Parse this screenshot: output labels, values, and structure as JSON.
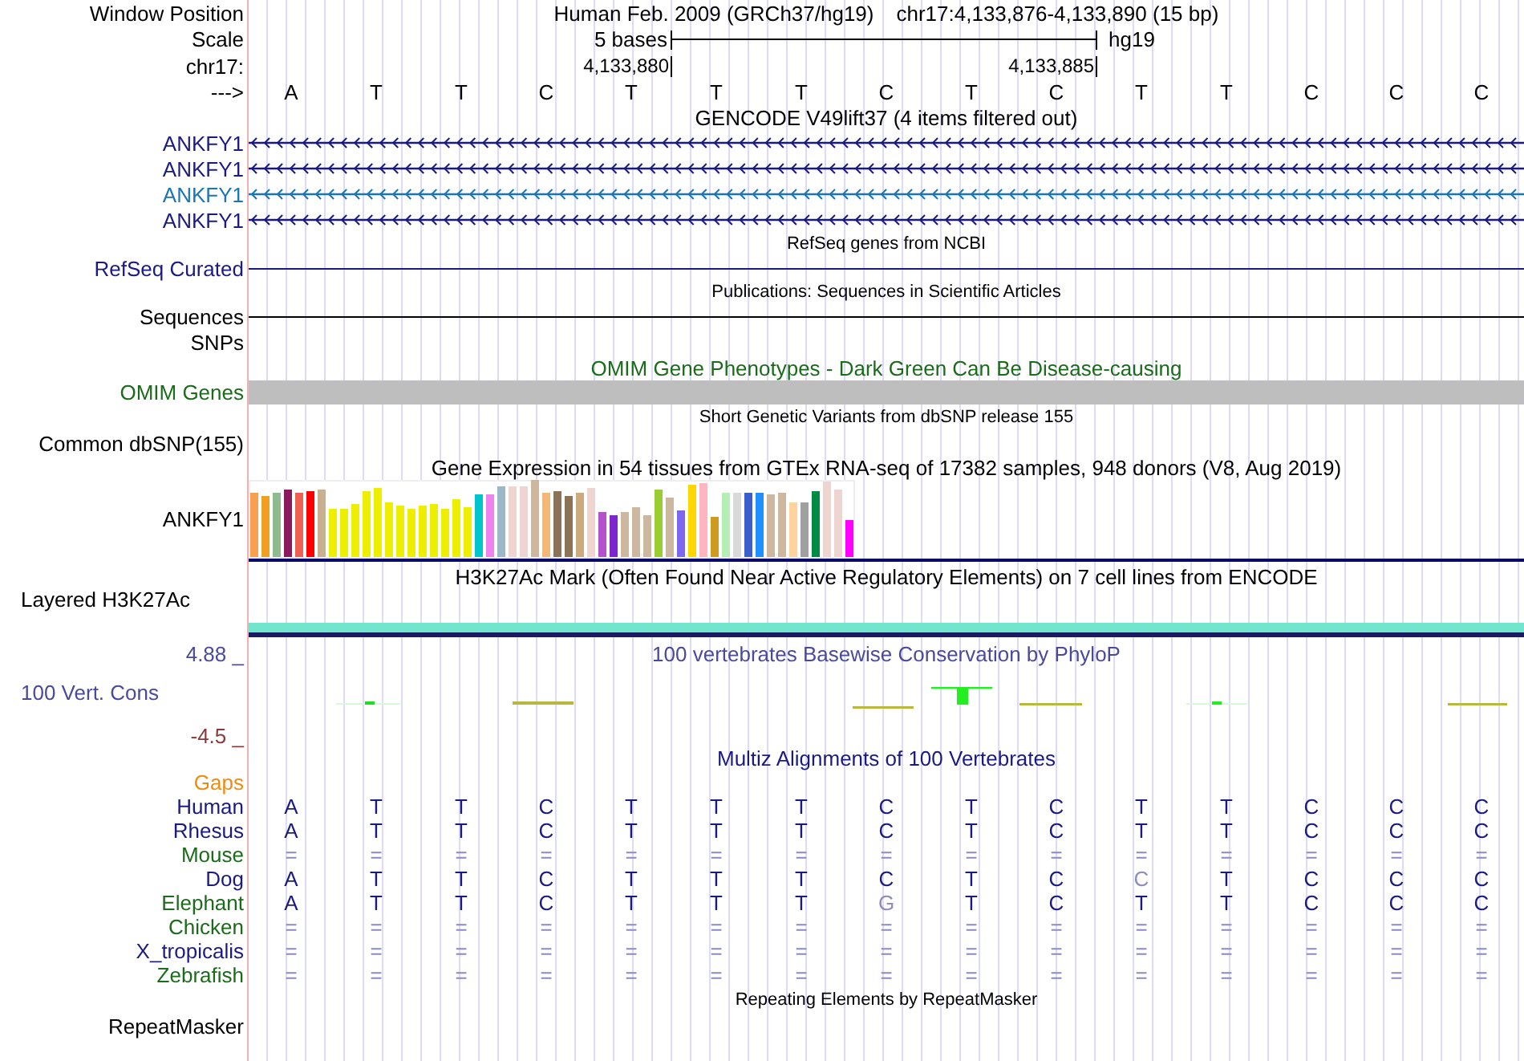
{
  "header": {
    "label": "Window Position",
    "title": "Human Feb. 2009 (GRCh37/hg19)",
    "position": "chr17:4,133,876-4,133,890 (15 bp)"
  },
  "scale": {
    "label": "Scale",
    "span": "5 bases",
    "assembly": "hg19"
  },
  "coordinates": {
    "label": "chr17:",
    "ticks": [
      "4,133,880",
      "4,133,885"
    ]
  },
  "sequence": {
    "label": "--->",
    "bases": [
      "A",
      "T",
      "T",
      "C",
      "T",
      "T",
      "T",
      "C",
      "T",
      "C",
      "T",
      "T",
      "C",
      "C",
      "C"
    ]
  },
  "tracks": [
    {
      "kind": "genes",
      "title": "GENCODE V49lift37 (4 items filtered out)",
      "items": [
        {
          "name": "ANKFY1",
          "color": "#1a1a80"
        },
        {
          "name": "ANKFY1",
          "color": "#1a1a80"
        },
        {
          "name": "ANKFY1",
          "color": "#1b75b5"
        },
        {
          "name": "ANKFY1",
          "color": "#1a1a80"
        }
      ]
    },
    {
      "kind": "line",
      "title": "RefSeq genes from NCBI",
      "label": "RefSeq Curated",
      "color": "#1a1a80"
    },
    {
      "kind": "line",
      "title": "Publications: Sequences in Scientific Articles",
      "label": "Sequences",
      "color": "#000000"
    },
    {
      "kind": "empty",
      "label": "SNPs",
      "color": "#000000"
    },
    {
      "kind": "omim",
      "title": "OMIM Gene Phenotypes - Dark Green Can Be Disease-causing",
      "label": "OMIM Genes",
      "color": "#1a6b1a"
    },
    {
      "kind": "empty",
      "title": "Short Genetic Variants from dbSNP release 155",
      "label": "Common dbSNP(155)",
      "color": "#000000"
    },
    {
      "kind": "expression",
      "title": "Gene Expression in 54 tissues from GTEx RNA-seq of 17382 samples, 948 donors (V8, Aug 2019)",
      "label": "ANKFY1",
      "color": "#000000"
    },
    {
      "kind": "layered",
      "title": "H3K27Ac Mark (Often Found Near Active Regulatory Elements) on 7 cell lines from ENCODE",
      "label": "Layered H3K27Ac",
      "color": "#000000"
    },
    {
      "kind": "conservation",
      "title": "100 vertebrates Basewise Conservation by PhyloP",
      "label": "100 Vert. Cons",
      "max": "4.88 _",
      "min": "-4.5 _",
      "color": "#4a4a9a"
    },
    {
      "kind": "alignment",
      "title": "Multiz Alignments of 100 Vertebrates",
      "gaps_label": "Gaps",
      "species": [
        {
          "name": "Human",
          "color": "#1a1a80",
          "bases": [
            {
              "b": "A",
              "faded": false
            },
            {
              "b": "T",
              "faded": false
            },
            {
              "b": "T",
              "faded": false
            },
            {
              "b": "C",
              "faded": false
            },
            {
              "b": "T",
              "faded": false
            },
            {
              "b": "T",
              "faded": false
            },
            {
              "b": "T",
              "faded": false
            },
            {
              "b": "C",
              "faded": false
            },
            {
              "b": "T",
              "faded": false
            },
            {
              "b": "C",
              "faded": false
            },
            {
              "b": "T",
              "faded": false
            },
            {
              "b": "T",
              "faded": false
            },
            {
              "b": "C",
              "faded": false
            },
            {
              "b": "C",
              "faded": false
            },
            {
              "b": "C",
              "faded": false
            }
          ]
        },
        {
          "name": "Rhesus",
          "color": "#1a1a80",
          "bases": [
            {
              "b": "A",
              "faded": false
            },
            {
              "b": "T",
              "faded": false
            },
            {
              "b": "T",
              "faded": false
            },
            {
              "b": "C",
              "faded": false
            },
            {
              "b": "T",
              "faded": false
            },
            {
              "b": "T",
              "faded": false
            },
            {
              "b": "T",
              "faded": false
            },
            {
              "b": "C",
              "faded": false
            },
            {
              "b": "T",
              "faded": false
            },
            {
              "b": "C",
              "faded": false
            },
            {
              "b": "T",
              "faded": false
            },
            {
              "b": "T",
              "faded": false
            },
            {
              "b": "C",
              "faded": false
            },
            {
              "b": "C",
              "faded": false
            },
            {
              "b": "C",
              "faded": false
            }
          ]
        },
        {
          "name": "Mouse",
          "color": "#1a6b1a",
          "bases": [
            {
              "b": "=",
              "faded": true
            },
            {
              "b": "=",
              "faded": true
            },
            {
              "b": "=",
              "faded": true
            },
            {
              "b": "=",
              "faded": true
            },
            {
              "b": "=",
              "faded": true
            },
            {
              "b": "=",
              "faded": true
            },
            {
              "b": "=",
              "faded": true
            },
            {
              "b": "=",
              "faded": true
            },
            {
              "b": "=",
              "faded": true
            },
            {
              "b": "=",
              "faded": true
            },
            {
              "b": "=",
              "faded": true
            },
            {
              "b": "=",
              "faded": true
            },
            {
              "b": "=",
              "faded": true
            },
            {
              "b": "=",
              "faded": true
            },
            {
              "b": "=",
              "faded": true
            }
          ]
        },
        {
          "name": "Dog",
          "color": "#1a1a80",
          "bases": [
            {
              "b": "A",
              "faded": false
            },
            {
              "b": "T",
              "faded": false
            },
            {
              "b": "T",
              "faded": false
            },
            {
              "b": "C",
              "faded": false
            },
            {
              "b": "T",
              "faded": false
            },
            {
              "b": "T",
              "faded": false
            },
            {
              "b": "T",
              "faded": false
            },
            {
              "b": "C",
              "faded": false
            },
            {
              "b": "T",
              "faded": false
            },
            {
              "b": "C",
              "faded": false
            },
            {
              "b": "C",
              "faded": true
            },
            {
              "b": "T",
              "faded": false
            },
            {
              "b": "C",
              "faded": false
            },
            {
              "b": "C",
              "faded": false
            },
            {
              "b": "C",
              "faded": false
            }
          ]
        },
        {
          "name": "Elephant",
          "color": "#1a6b1a",
          "bases": [
            {
              "b": "A",
              "faded": false
            },
            {
              "b": "T",
              "faded": false
            },
            {
              "b": "T",
              "faded": false
            },
            {
              "b": "C",
              "faded": false
            },
            {
              "b": "T",
              "faded": false
            },
            {
              "b": "T",
              "faded": false
            },
            {
              "b": "T",
              "faded": false
            },
            {
              "b": "G",
              "faded": true
            },
            {
              "b": "T",
              "faded": false
            },
            {
              "b": "C",
              "faded": false
            },
            {
              "b": "T",
              "faded": false
            },
            {
              "b": "T",
              "faded": false
            },
            {
              "b": "C",
              "faded": false
            },
            {
              "b": "C",
              "faded": false
            },
            {
              "b": "C",
              "faded": false
            }
          ]
        },
        {
          "name": "Chicken",
          "color": "#1a6b1a",
          "bases": [
            {
              "b": "=",
              "faded": true
            },
            {
              "b": "=",
              "faded": true
            },
            {
              "b": "=",
              "faded": true
            },
            {
              "b": "=",
              "faded": true
            },
            {
              "b": "=",
              "faded": true
            },
            {
              "b": "=",
              "faded": true
            },
            {
              "b": "=",
              "faded": true
            },
            {
              "b": "=",
              "faded": true
            },
            {
              "b": "=",
              "faded": true
            },
            {
              "b": "=",
              "faded": true
            },
            {
              "b": "=",
              "faded": true
            },
            {
              "b": "=",
              "faded": true
            },
            {
              "b": "=",
              "faded": true
            },
            {
              "b": "=",
              "faded": true
            },
            {
              "b": "=",
              "faded": true
            }
          ]
        },
        {
          "name": "X_tropicalis",
          "color": "#1a1a80",
          "bases": [
            {
              "b": "=",
              "faded": true
            },
            {
              "b": "=",
              "faded": true
            },
            {
              "b": "=",
              "faded": true
            },
            {
              "b": "=",
              "faded": true
            },
            {
              "b": "=",
              "faded": true
            },
            {
              "b": "=",
              "faded": true
            },
            {
              "b": "=",
              "faded": true
            },
            {
              "b": "=",
              "faded": true
            },
            {
              "b": "=",
              "faded": true
            },
            {
              "b": "=",
              "faded": true
            },
            {
              "b": "=",
              "faded": true
            },
            {
              "b": "=",
              "faded": true
            },
            {
              "b": "=",
              "faded": true
            },
            {
              "b": "=",
              "faded": true
            },
            {
              "b": "=",
              "faded": true
            }
          ]
        },
        {
          "name": "Zebrafish",
          "color": "#1a6b1a",
          "bases": [
            {
              "b": "=",
              "faded": true
            },
            {
              "b": "=",
              "faded": true
            },
            {
              "b": "=",
              "faded": true
            },
            {
              "b": "=",
              "faded": true
            },
            {
              "b": "=",
              "faded": true
            },
            {
              "b": "=",
              "faded": true
            },
            {
              "b": "=",
              "faded": true
            },
            {
              "b": "=",
              "faded": true
            },
            {
              "b": "=",
              "faded": true
            },
            {
              "b": "=",
              "faded": true
            },
            {
              "b": "=",
              "faded": true
            },
            {
              "b": "=",
              "faded": true
            },
            {
              "b": "=",
              "faded": true
            },
            {
              "b": "=",
              "faded": true
            },
            {
              "b": "=",
              "faded": true
            }
          ]
        }
      ]
    },
    {
      "kind": "empty",
      "title": "Repeating Elements by RepeatMasker",
      "label": "RepeatMasker",
      "color": "#000000"
    }
  ]
}
